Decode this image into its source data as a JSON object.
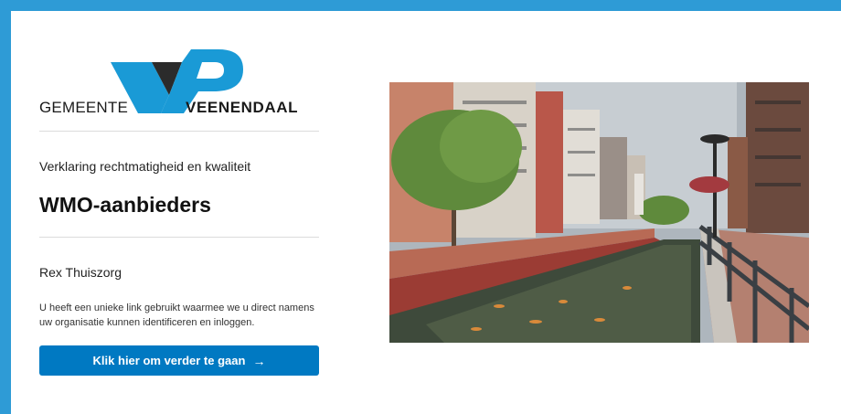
{
  "logo": {
    "left_word": "GEMEENTE",
    "right_word": "VEENENDAAL"
  },
  "login": {
    "subtitle": "Verklaring rechtmatigheid en kwaliteit",
    "title": "WMO-aanbieders",
    "organisation": "Rex Thuiszorg",
    "info": "U heeft een unieke link gebruikt waarmee we u direct namens uw organisatie kunnen identificeren en inloggen.",
    "button_label": "Klik hier om verder te gaan",
    "button_arrow": "→"
  },
  "colors": {
    "brand_blue": "#2e9bd6",
    "button_blue": "#0079c2",
    "logo_blue": "#1a9ad6",
    "logo_dark": "#2b2b2b"
  }
}
